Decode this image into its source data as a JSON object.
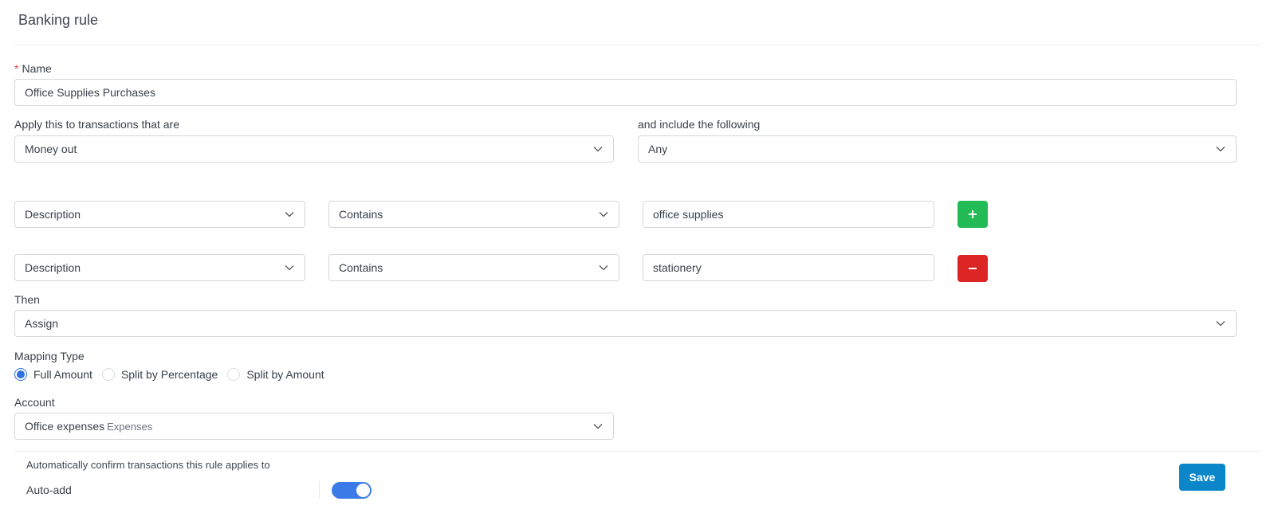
{
  "header": {
    "title": "Banking rule"
  },
  "name_field": {
    "required_mark": "*",
    "label": "Name",
    "value": "Office Supplies Purchases"
  },
  "apply_to": {
    "label": "Apply this to transactions that are",
    "value": "Money out"
  },
  "include": {
    "label": "and include the following",
    "value": "Any"
  },
  "conditions": [
    {
      "field": "Description",
      "operator": "Contains",
      "value": "office supplies",
      "action": "add",
      "action_icon": "plus-icon",
      "action_color": "#22bb55"
    },
    {
      "field": "Description",
      "operator": "Contains",
      "value": "stationery",
      "action": "remove",
      "action_icon": "minus-icon",
      "action_color": "#dc2626"
    }
  ],
  "then": {
    "label": "Then",
    "value": "Assign"
  },
  "mapping_type": {
    "label": "Mapping Type",
    "options": [
      {
        "label": "Full Amount",
        "selected": true
      },
      {
        "label": "Split by Percentage",
        "selected": false
      },
      {
        "label": "Split by Amount",
        "selected": false
      }
    ]
  },
  "account": {
    "label": "Account",
    "value": "Office expenses",
    "sub_value": "Expenses"
  },
  "auto_confirm": {
    "description": "Automatically confirm transactions this rule applies to",
    "label": "Auto-add",
    "enabled": true
  },
  "footer": {
    "save_label": "Save"
  },
  "colors": {
    "accent": "#3b7be8",
    "save": "#0a86c9",
    "add": "#22bb55",
    "remove": "#dc2626",
    "required": "#e04646"
  }
}
